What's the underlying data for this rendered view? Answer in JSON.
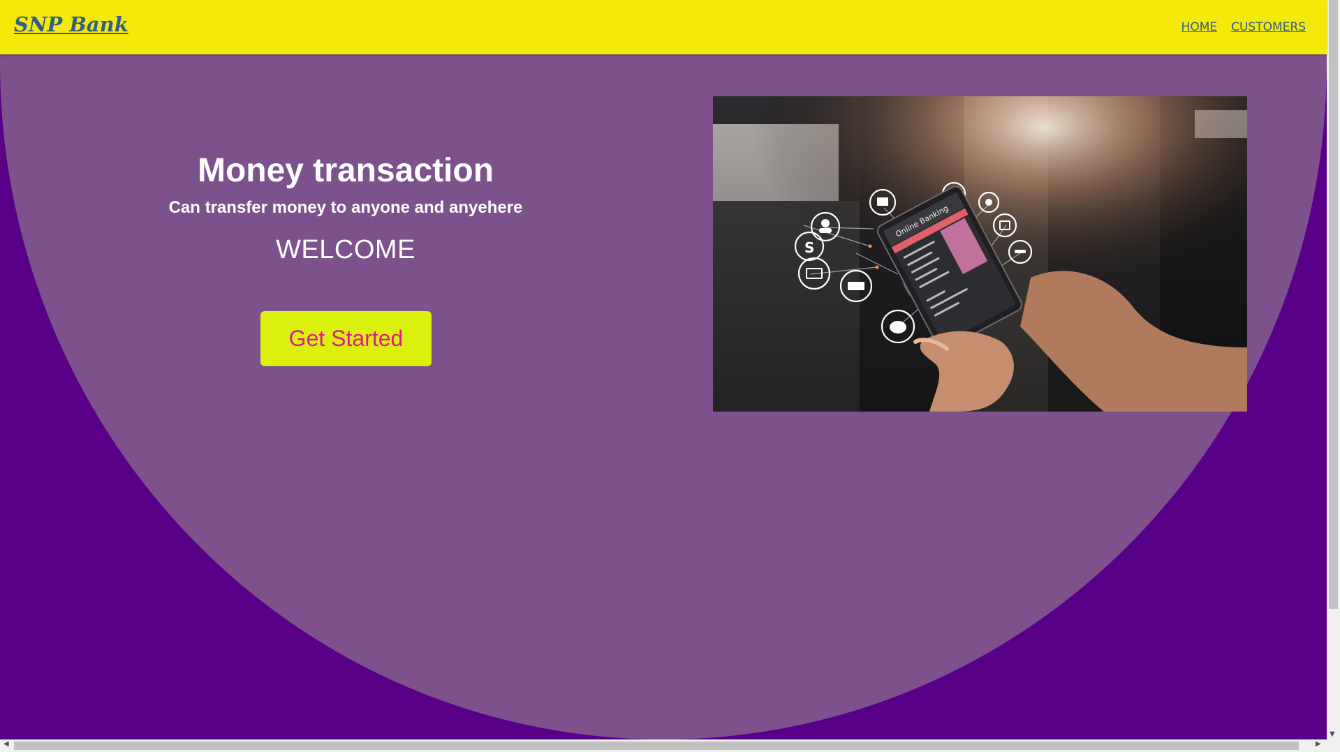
{
  "brand": {
    "name": "SNP Bank"
  },
  "nav": {
    "items": [
      {
        "label": "HOME"
      },
      {
        "label": "CUSTOMERS"
      }
    ]
  },
  "hero": {
    "title": "Money transaction",
    "subtitle": "Can transfer money to anyone and anyehere",
    "welcome": "WELCOME",
    "cta_label": "Get Started",
    "image_alt": "Hands holding a tablet with Online Banking app and floating finance icons",
    "tablet_screen_text": "Online Banking"
  },
  "colors": {
    "navbar_bg": "#f5e90a",
    "brand_text": "#2e5f86",
    "page_bg": "#580087",
    "hero_circle": "#7c518c",
    "cta_bg": "#dcf00d",
    "cta_text": "#e0198c",
    "hero_text": "#ffffff"
  }
}
